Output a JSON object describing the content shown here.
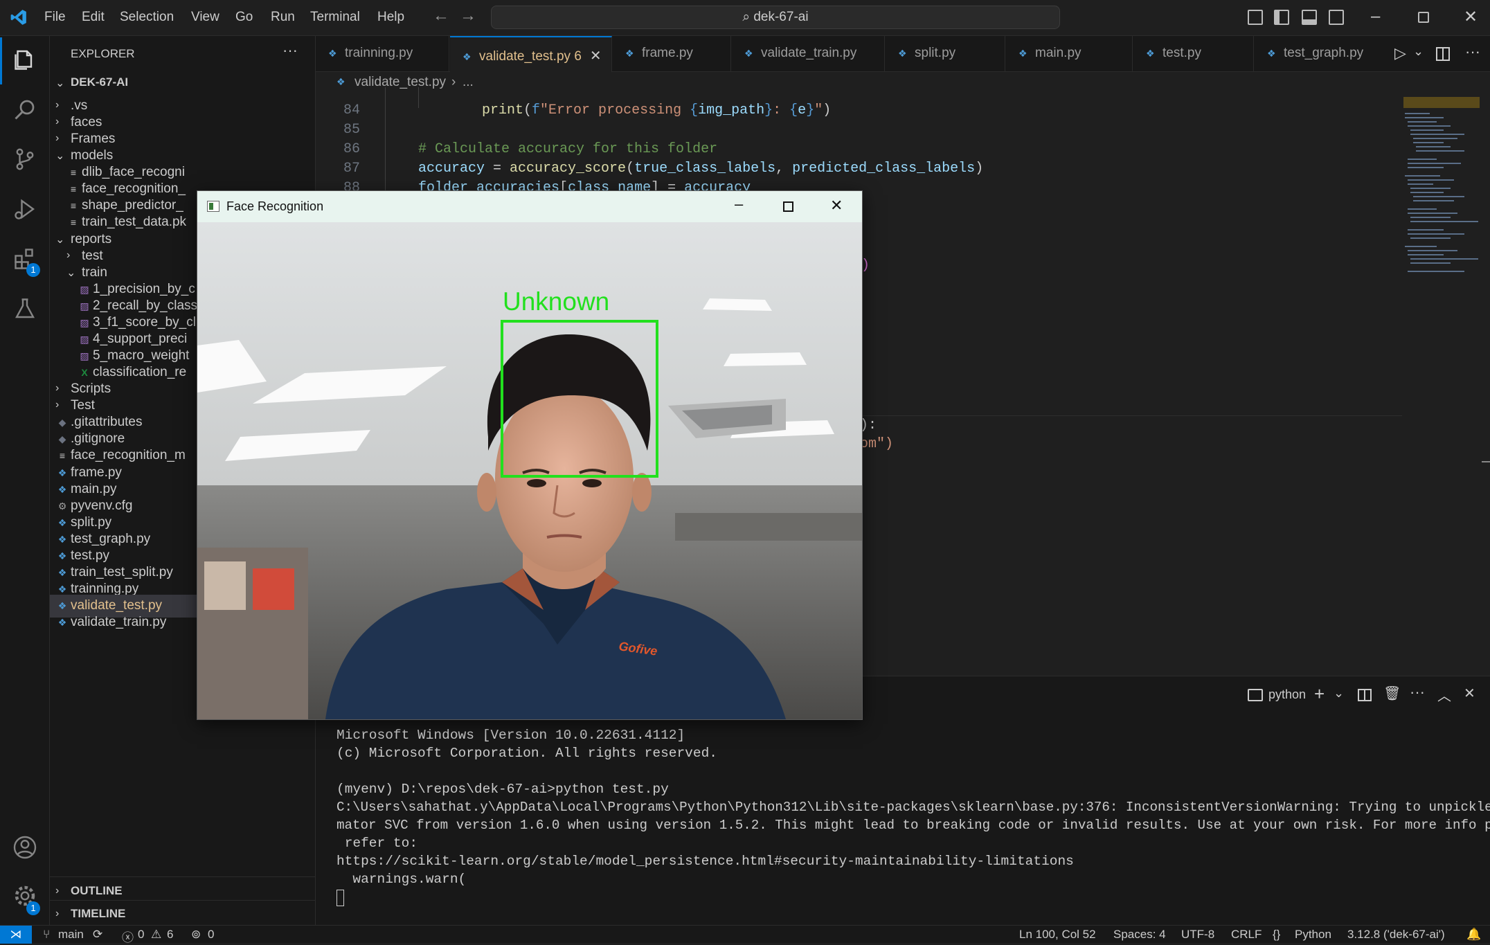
{
  "menu": [
    "File",
    "Edit",
    "Selection",
    "View",
    "Go",
    "Run",
    "Terminal",
    "Help"
  ],
  "command_center": "dek-67-ai",
  "activity_badges": {
    "extensions": "1",
    "accounts_settings": "1"
  },
  "explorer": {
    "title": "EXPLORER",
    "root": "DEK-67-AI",
    "items": [
      {
        "label": ".vs",
        "kind": "folder-closed",
        "depth": 1
      },
      {
        "label": "faces",
        "kind": "folder-closed",
        "depth": 1
      },
      {
        "label": "Frames",
        "kind": "folder-closed",
        "depth": 1
      },
      {
        "label": "models",
        "kind": "folder-open",
        "depth": 1
      },
      {
        "label": "dlib_face_recogni",
        "kind": "file-text",
        "depth": 2
      },
      {
        "label": "face_recognition_",
        "kind": "file-text",
        "depth": 2
      },
      {
        "label": "shape_predictor_",
        "kind": "file-text",
        "depth": 2
      },
      {
        "label": "train_test_data.pk",
        "kind": "file-text",
        "depth": 2
      },
      {
        "label": "reports",
        "kind": "folder-open",
        "depth": 1
      },
      {
        "label": "test",
        "kind": "folder-closed",
        "depth": 2
      },
      {
        "label": "train",
        "kind": "folder-open",
        "depth": 2
      },
      {
        "label": "1_precision_by_c",
        "kind": "file-image",
        "depth": 3
      },
      {
        "label": "2_recall_by_class",
        "kind": "file-image",
        "depth": 3
      },
      {
        "label": "3_f1_score_by_cl",
        "kind": "file-image",
        "depth": 3
      },
      {
        "label": "4_support_preci",
        "kind": "file-image",
        "depth": 3
      },
      {
        "label": "5_macro_weight",
        "kind": "file-image",
        "depth": 3
      },
      {
        "label": "classification_re",
        "kind": "file-excel",
        "depth": 3
      },
      {
        "label": "Scripts",
        "kind": "folder-closed",
        "depth": 1
      },
      {
        "label": "Test",
        "kind": "folder-closed",
        "depth": 1
      },
      {
        "label": ".gitattributes",
        "kind": "file-git",
        "depth": 1
      },
      {
        "label": ".gitignore",
        "kind": "file-git",
        "depth": 1
      },
      {
        "label": "face_recognition_m",
        "kind": "file-text",
        "depth": 1
      },
      {
        "label": "frame.py",
        "kind": "file-py",
        "depth": 1
      },
      {
        "label": "main.py",
        "kind": "file-py",
        "depth": 1
      },
      {
        "label": "pyvenv.cfg",
        "kind": "file-cfg",
        "depth": 1
      },
      {
        "label": "split.py",
        "kind": "file-py",
        "depth": 1
      },
      {
        "label": "test_graph.py",
        "kind": "file-py",
        "depth": 1
      },
      {
        "label": "test.py",
        "kind": "file-py",
        "depth": 1
      },
      {
        "label": "train_test_split.py",
        "kind": "file-py",
        "depth": 1
      },
      {
        "label": "trainning.py",
        "kind": "file-py",
        "depth": 1
      },
      {
        "label": "validate_test.py",
        "kind": "file-py",
        "depth": 1,
        "selected": true,
        "badge": "6"
      },
      {
        "label": "validate_train.py",
        "kind": "file-py",
        "depth": 1
      }
    ],
    "outline": "OUTLINE",
    "timeline": "TIMELINE"
  },
  "tabs": [
    {
      "label": "trainning.py"
    },
    {
      "label": "validate_test.py",
      "active": true,
      "problems": "6"
    },
    {
      "label": "frame.py"
    },
    {
      "label": "validate_train.py"
    },
    {
      "label": "split.py"
    },
    {
      "label": "main.py"
    },
    {
      "label": "test.py"
    },
    {
      "label": "test_graph.py"
    }
  ],
  "breadcrumb": {
    "file": "validate_test.py",
    "rest": "..."
  },
  "editor": {
    "lines": [
      {
        "n": "84",
        "text": "print(f\"Error processing {img_path}: {e}\")"
      },
      {
        "n": "85",
        "text": ""
      },
      {
        "n": "86",
        "text": "# Calculate accuracy for this folder"
      },
      {
        "n": "87",
        "text": "accuracy = accuracy_score(true_class_labels, predicted_class_labels)"
      },
      {
        "n": "88",
        "text": "folder_accuracies[class_name] = accuracy"
      }
    ],
    "fragments": [
      ")",
      "):",
      "om\")"
    ]
  },
  "face_window": {
    "title": "Face Recognition",
    "detection_label": "Unknown",
    "shirt_logo": "Gofive"
  },
  "terminal": {
    "shell": "python",
    "lines": [
      "Microsoft Windows [Version 10.0.22631.4112]",
      "(c) Microsoft Corporation. All rights reserved.",
      "",
      "(myenv) D:\\repos\\dek-67-ai>python test.py",
      "C:\\Users\\sahathat.y\\AppData\\Local\\Programs\\Python\\Python312\\Lib\\site-packages\\sklearn\\base.py:376: InconsistentVersionWarning: Trying to unpickle esti",
      "mator SVC from version 1.6.0 when using version 1.5.2. This might lead to breaking code or invalid results. Use at your own risk. For more info please",
      " refer to:",
      "https://scikit-learn.org/stable/model_persistence.html#security-maintainability-limitations",
      "  warnings.warn("
    ]
  },
  "status": {
    "branch": "main",
    "errors": "0",
    "warnings": "6",
    "ports": "0",
    "position": "Ln 100, Col 52",
    "spaces": "Spaces: 4",
    "encoding": "UTF-8",
    "eol": "CRLF",
    "language": "Python",
    "interpreter": "3.12.8 ('dek-67-ai')"
  },
  "colors": {
    "accent": "#0078d4",
    "detection_box": "#22e01e",
    "modified_tab": "#e2c08d"
  }
}
